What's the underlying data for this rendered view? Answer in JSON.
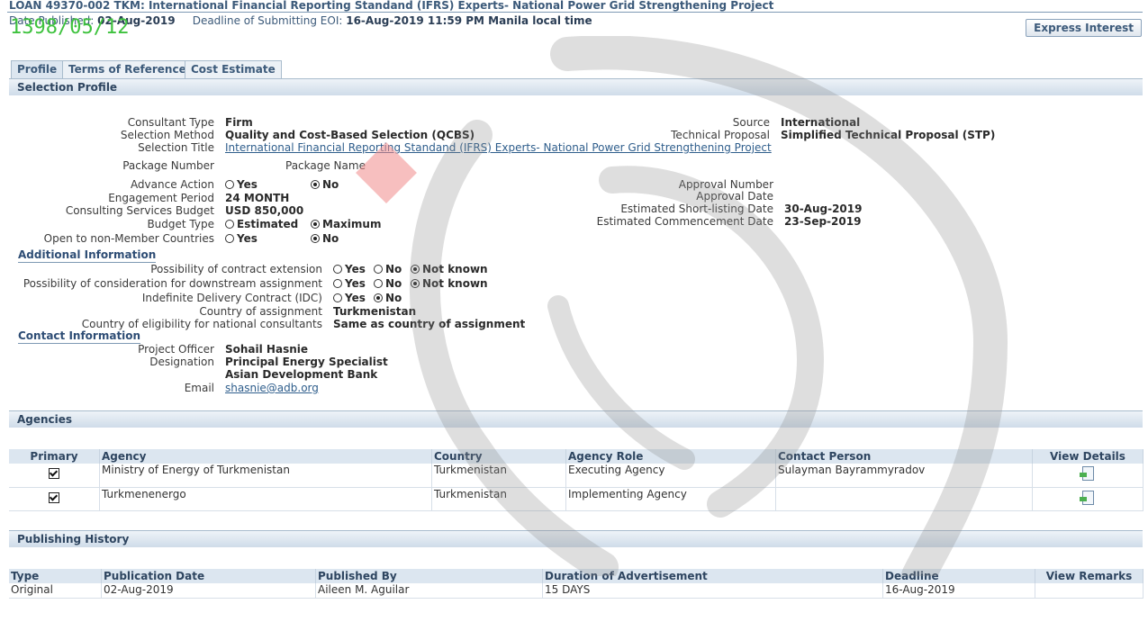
{
  "header": {
    "title": "LOAN 49370-002 TKM: International Financial Reporting Standand (IFRS) Experts- National Power Grid Strengthening Project",
    "date_published_label": "Date Published:",
    "date_published": "02-Aug-2019",
    "deadline_label": "Deadline of Submitting EOI:",
    "deadline": "16-Aug-2019 11:59 PM Manila local time",
    "stamp": "1398/05/12",
    "express_interest_button": "Express Interest"
  },
  "tabs": [
    {
      "label": "Profile",
      "active": true
    },
    {
      "label": "Terms of Reference",
      "active": false
    },
    {
      "label": "Cost Estimate",
      "active": false
    }
  ],
  "selection_profile": {
    "section_title": "Selection Profile",
    "consultant_type_label": "Consultant Type",
    "consultant_type": "Firm",
    "selection_method_label": "Selection Method",
    "selection_method": "Quality and Cost-Based Selection (QCBS)",
    "selection_title_label": "Selection Title",
    "selection_title": "International Financial Reporting Standand (IFRS) Experts- National Power Grid Strengthening Project",
    "package_number_label": "Package Number",
    "package_name_label": "Package Name",
    "advance_action_label": "Advance Action",
    "engagement_period_label": "Engagement Period",
    "engagement_period": "24 MONTH",
    "budget_label": "Consulting Services Budget",
    "budget": "USD 850,000",
    "budget_type_label": "Budget Type",
    "open_label": "Open to non-Member Countries",
    "opt_yes": "Yes",
    "opt_no": "No",
    "opt_estimated": "Estimated",
    "opt_maximum": "Maximum",
    "opt_not_known": "Not known",
    "source_label": "Source",
    "source": "International",
    "technical_proposal_label": "Technical Proposal",
    "technical_proposal": "Simplified Technical Proposal (STP)",
    "approval_number_label": "Approval Number",
    "approval_date_label": "Approval Date",
    "shortlisting_date_label": "Estimated Short-listing Date",
    "shortlisting_date": "30-Aug-2019",
    "commencement_date_label": "Estimated Commencement Date",
    "commencement_date": "23-Sep-2019"
  },
  "additional_info": {
    "heading": "Additional Information",
    "extension_label": "Possibility of contract extension",
    "downstream_label": "Possibility of consideration for downstream assignment",
    "idc_label": "Indefinite Delivery Contract (IDC)",
    "country_label": "Country of assignment",
    "country": "Turkmenistan",
    "eligibility_label": "Country of eligibility for national consultants",
    "eligibility": "Same as country of assignment"
  },
  "contact_info": {
    "heading": "Contact Information",
    "officer_label": "Project Officer",
    "officer": "Sohail Hasnie",
    "designation_label": "Designation",
    "designation": "Principal Energy Specialist",
    "organization": "Asian Development Bank",
    "email_label": "Email",
    "email": "shasnie@adb.org"
  },
  "agencies": {
    "section_title": "Agencies",
    "columns": [
      "Primary",
      "Agency",
      "Country",
      "Agency Role",
      "Contact Person",
      "View Details"
    ],
    "rows": [
      {
        "agency": "Ministry of Energy of Turkmenistan",
        "country": "Turkmenistan",
        "role": "Executing Agency",
        "contact": "Sulayman Bayrammyradov",
        "primary": true
      },
      {
        "agency": "Turkmenenergo",
        "country": "Turkmenistan",
        "role": "Implementing Agency",
        "contact": "",
        "primary": true
      }
    ]
  },
  "publishing_history": {
    "section_title": "Publishing History",
    "columns": [
      "Type",
      "Publication Date",
      "Published By",
      "Duration of Advertisement",
      "Deadline",
      "View Remarks"
    ],
    "rows": [
      {
        "type": "Original",
        "date": "02-Aug-2019",
        "by": "Aileen M. Aguilar",
        "duration": "15 DAYS",
        "deadline": "16-Aug-2019",
        "remarks": ""
      }
    ]
  },
  "colors": {
    "header_text": "#3c5a7a",
    "stamp": "#3ec23e",
    "section_bar": "#cfdce9",
    "watermark": "#7a7a7a"
  }
}
